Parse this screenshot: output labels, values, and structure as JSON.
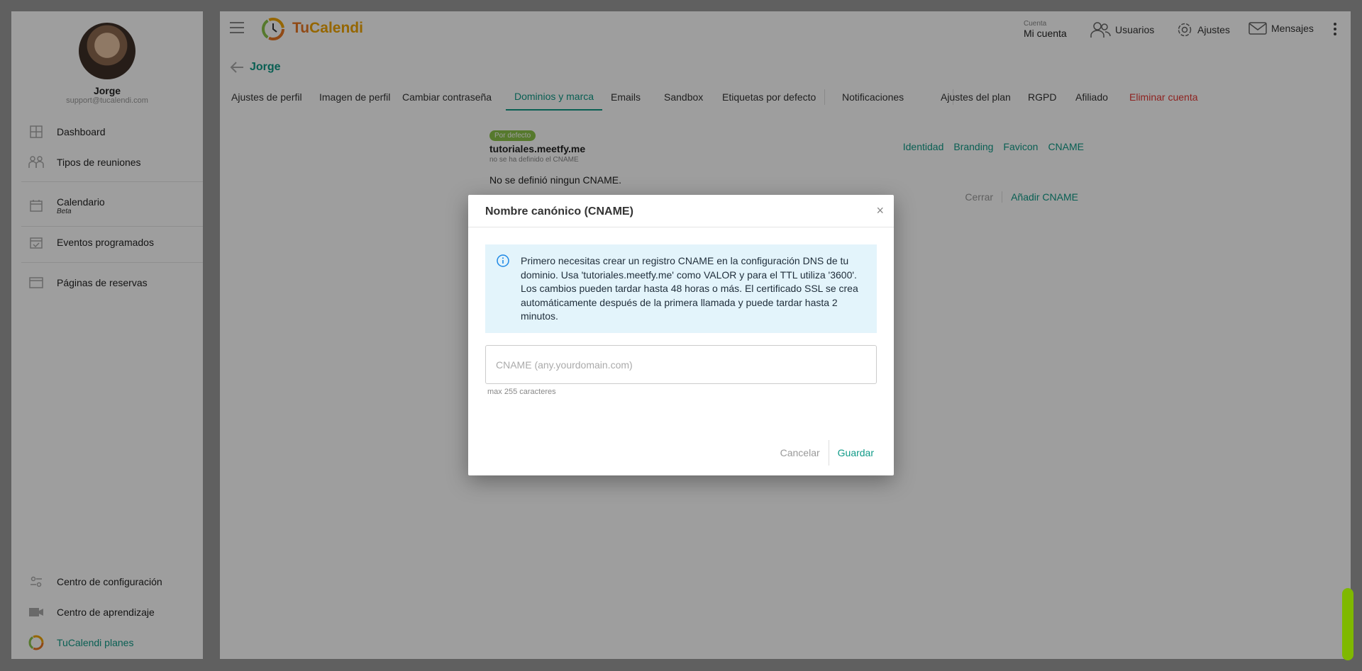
{
  "sidebar": {
    "user_name": "Jorge",
    "user_email": "support@tucalendi.com",
    "items": [
      {
        "label": "Dashboard"
      },
      {
        "label": "Tipos de reuniones"
      },
      {
        "label": "Calendario",
        "sub": "Beta"
      },
      {
        "label": "Eventos programados"
      },
      {
        "label": "Páginas de reservas"
      }
    ],
    "bottom_items": [
      {
        "label": "Centro de configuración"
      },
      {
        "label": "Centro de aprendizaje"
      },
      {
        "label": "TuCalendi planes"
      }
    ]
  },
  "topbar": {
    "logo_tu": "Tu",
    "logo_rest": "Calendi",
    "account_small": "Cuenta",
    "account_big": "Mi cuenta",
    "users": "Usuarios",
    "settings": "Ajustes",
    "messages": "Mensajes"
  },
  "page": {
    "back_title": "Jorge",
    "tabs": [
      "Ajustes de perfil",
      "Imagen de perfil",
      "Cambiar contraseña",
      "Dominios y marca",
      "Emails",
      "Sandbox",
      "Etiquetas por defecto",
      "Notificaciones",
      "Ajustes del plan",
      "RGPD",
      "Afiliado",
      "Eliminar cuenta"
    ]
  },
  "domain_card": {
    "badge": "Por defecto",
    "domain": "tutoriales.meetfy.me",
    "note": "no se ha definido el CNAME",
    "links": [
      "Identidad",
      "Branding",
      "Favicon",
      "CNAME"
    ],
    "no_cname": "No se definió ningun CNAME.",
    "close": "Cerrar",
    "add": "Añadir CNAME"
  },
  "modal": {
    "title": "Nombre canónico (CNAME)",
    "close": "×",
    "info": "Primero necesitas crear un registro CNAME en la configuración DNS de tu dominio. Usa 'tutoriales.meetfy.me' como VALOR y para el TTL utiliza '3600'. Los cambios pueden tardar hasta 48 horas o más. El certificado SSL se crea automáticamente después de la primera llamada y puede tardar hasta 2 minutos.",
    "input_value": "",
    "input_placeholder": "CNAME (any.yourdomain.com)",
    "hint": "max 255 caracteres",
    "cancel": "Cancelar",
    "save": "Guardar"
  },
  "colors": {
    "accent": "#0f9a87",
    "danger": "#e53935",
    "info_bg": "#e3f4fb",
    "badge": "#8bc34a"
  }
}
